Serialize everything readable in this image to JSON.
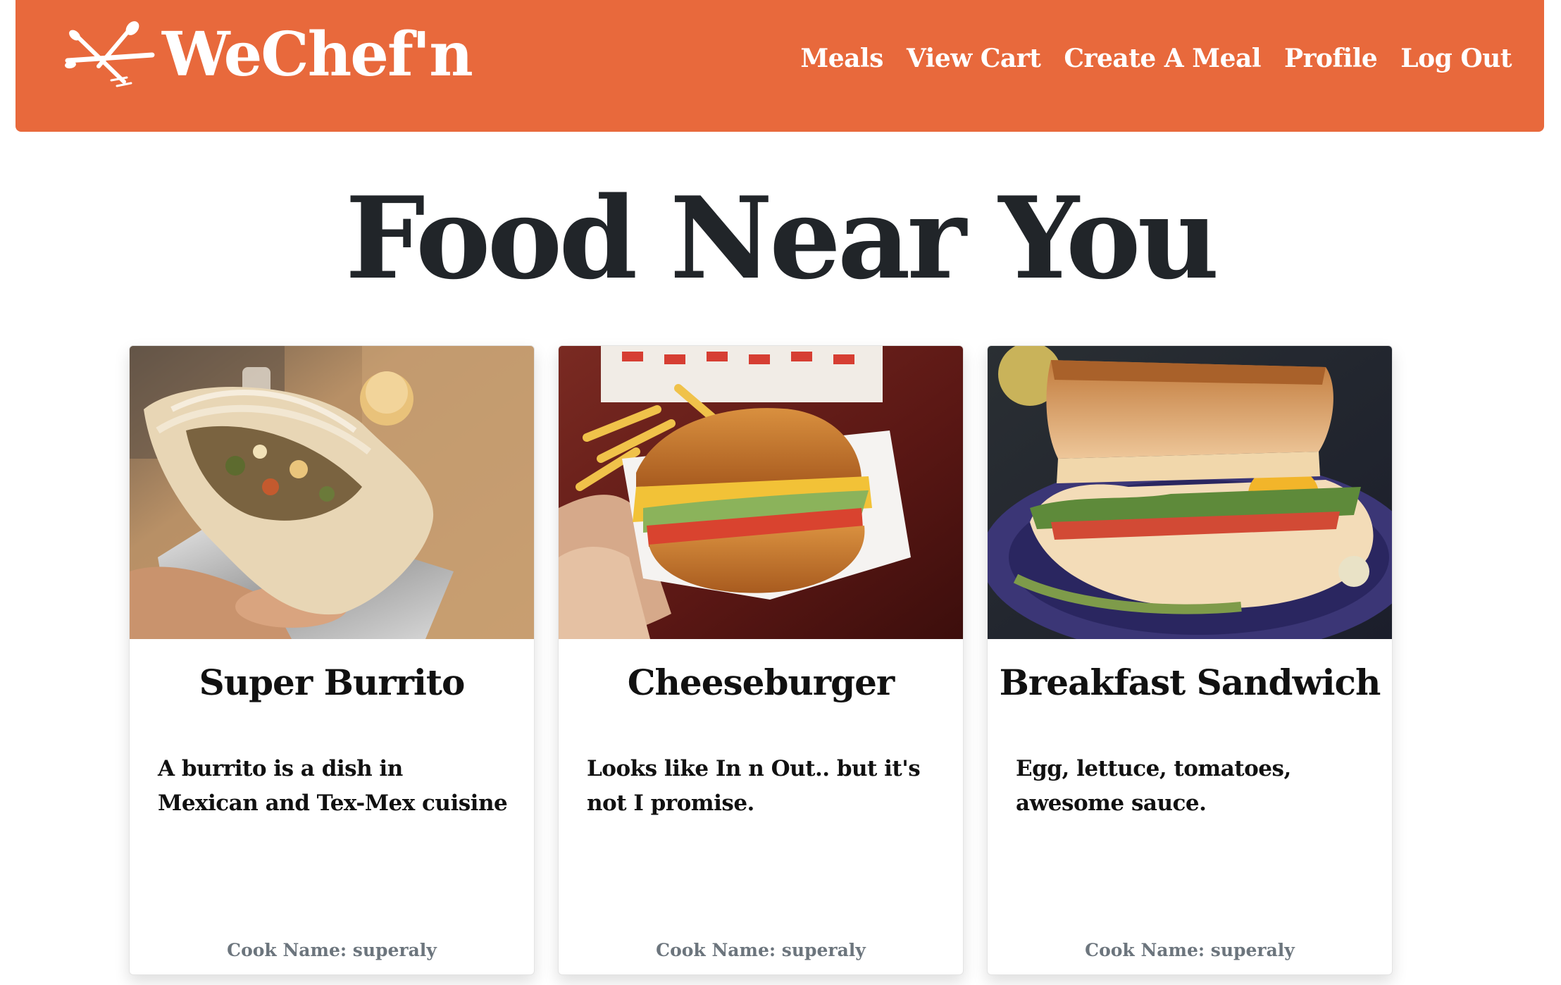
{
  "brand": {
    "name": "WeChef'n",
    "logo_icon": "fork-spoon-knife-icon"
  },
  "nav": {
    "links": [
      "Meals",
      "View Cart",
      "Create A Meal",
      "Profile",
      "Log Out"
    ]
  },
  "page": {
    "title": "Food Near You"
  },
  "meals": [
    {
      "name": "Super Burrito",
      "description": "A burrito is a dish in Mexican and Tex-Mex cuisine",
      "cook": "Cook Name: superaly"
    },
    {
      "name": "Cheeseburger",
      "description": "Looks like In n Out.. but it's not I promise.",
      "cook": "Cook Name: superaly"
    },
    {
      "name": "Breakfast Sandwich",
      "description": "Egg, lettuce, tomatoes, awesome sauce.",
      "cook": "Cook Name: superaly"
    }
  ],
  "colors": {
    "navbar": "#e8693c",
    "title_text": "#212529",
    "muted_text": "#6c757d"
  }
}
